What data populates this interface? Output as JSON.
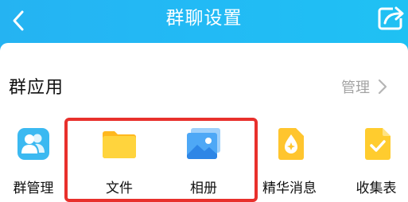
{
  "header": {
    "title": "群聊设置",
    "back_icon": "chevron-left-icon",
    "share_icon": "share-icon",
    "background": "#22baf5"
  },
  "section": {
    "title": "群应用",
    "manage_label": "管理",
    "manage_icon": "chevron-right-icon"
  },
  "apps": [
    {
      "label": "群管理",
      "icon": "group-manage-icon",
      "color": "#38b8f0"
    },
    {
      "label": "文件",
      "icon": "folder-icon",
      "color": "#ffc933"
    },
    {
      "label": "相册",
      "icon": "photo-album-icon",
      "color": "#4aa5f5"
    },
    {
      "label": "精华消息",
      "icon": "essence-message-icon",
      "color": "#ffc52e"
    },
    {
      "label": "收集表",
      "icon": "collection-form-icon",
      "color": "#ffcc2e"
    }
  ],
  "highlight": {
    "color": "#e8302c",
    "covers": [
      "文件",
      "相册"
    ]
  }
}
